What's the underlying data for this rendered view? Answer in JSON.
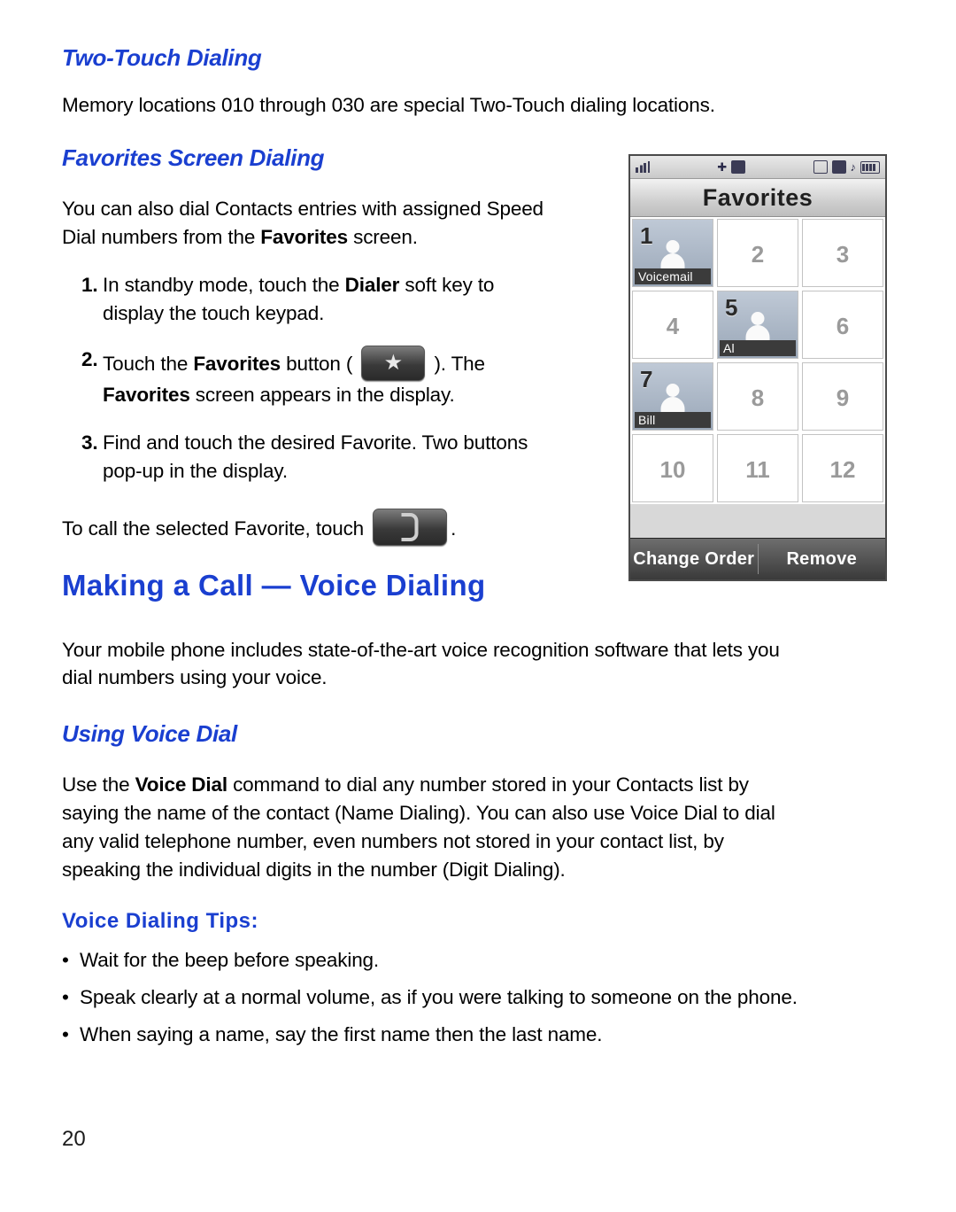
{
  "page": {
    "number": "20"
  },
  "sections": {
    "two_touch_heading": "Two-Touch Dialing",
    "two_touch_body": "Memory locations 010 through 030 are special Two-Touch dialing locations.",
    "favorites_heading": "Favorites Screen Dialing",
    "favorites_body_1": "You can also dial Contacts entries with assigned Speed",
    "favorites_body_2_pre": "Dial numbers from the ",
    "favorites_body_2_bold": "Favorites",
    "favorites_body_2_post": " screen.",
    "step1_num": "1.",
    "step1_pre": "In standby mode, touch the ",
    "step1_bold": "Dialer",
    "step1_post": " soft key to",
    "step1_line2": "display the touch keypad.",
    "step2_num": "2.",
    "step2_pre": "Touch the ",
    "step2_bold": "Favorites",
    "step2_mid": " button ( ",
    "step2_post": " ). The",
    "step2_line2_bold": "Favorites",
    "step2_line2_post": " screen appears in the display.",
    "step3_num": "3.",
    "step3_text": "Find and touch the desired Favorite. Two buttons",
    "step3_line2": "pop-up in the display.",
    "call_favorite_pre": "To call the selected Favorite, touch",
    "call_favorite_post": ".",
    "chapter_heading": "Making a Call — Voice Dialing",
    "chapter_body_1": "Your mobile phone includes state-of-the-art voice recognition software that lets you",
    "chapter_body_2": "dial numbers using your voice.",
    "using_voice_heading": "Using Voice Dial",
    "using_voice_1_pre": "Use the ",
    "using_voice_1_bold": "Voice Dial",
    "using_voice_1_post": " command to dial any number stored in your Contacts list by",
    "using_voice_2": "saying the name of the contact (Name Dialing). You can also use Voice Dial to dial",
    "using_voice_3": "any valid telephone number, even numbers not stored in your contact list, by",
    "using_voice_4": "speaking the individual digits in the number (Digit Dialing).",
    "tips_heading": "Voice Dialing Tips:",
    "tips": [
      "Wait for the beep before speaking.",
      "Speak clearly at a normal volume, as if you were talking to someone on the phone.",
      " When saying a name, say the first name then the last name."
    ]
  },
  "phone_screenshot": {
    "title": "Favorites",
    "status_icons": [
      "signal-bars-icon",
      "gps-icon",
      "bluetooth-icon",
      "message-icon",
      "alarm-icon",
      "music-note-icon",
      "battery-icon"
    ],
    "grid": [
      {
        "number": "1",
        "label": "Voicemail",
        "assigned": true
      },
      {
        "number": "2",
        "label": "",
        "assigned": false
      },
      {
        "number": "3",
        "label": "",
        "assigned": false
      },
      {
        "number": "4",
        "label": "",
        "assigned": false
      },
      {
        "number": "5",
        "label": "Al",
        "assigned": true
      },
      {
        "number": "6",
        "label": "",
        "assigned": false
      },
      {
        "number": "7",
        "label": "Bill",
        "assigned": true
      },
      {
        "number": "8",
        "label": "",
        "assigned": false
      },
      {
        "number": "9",
        "label": "",
        "assigned": false
      },
      {
        "number": "10",
        "label": "",
        "assigned": false
      },
      {
        "number": "11",
        "label": "",
        "assigned": false
      },
      {
        "number": "12",
        "label": "",
        "assigned": false
      }
    ],
    "softkey_left": "Change Order",
    "softkey_right": "Remove"
  }
}
